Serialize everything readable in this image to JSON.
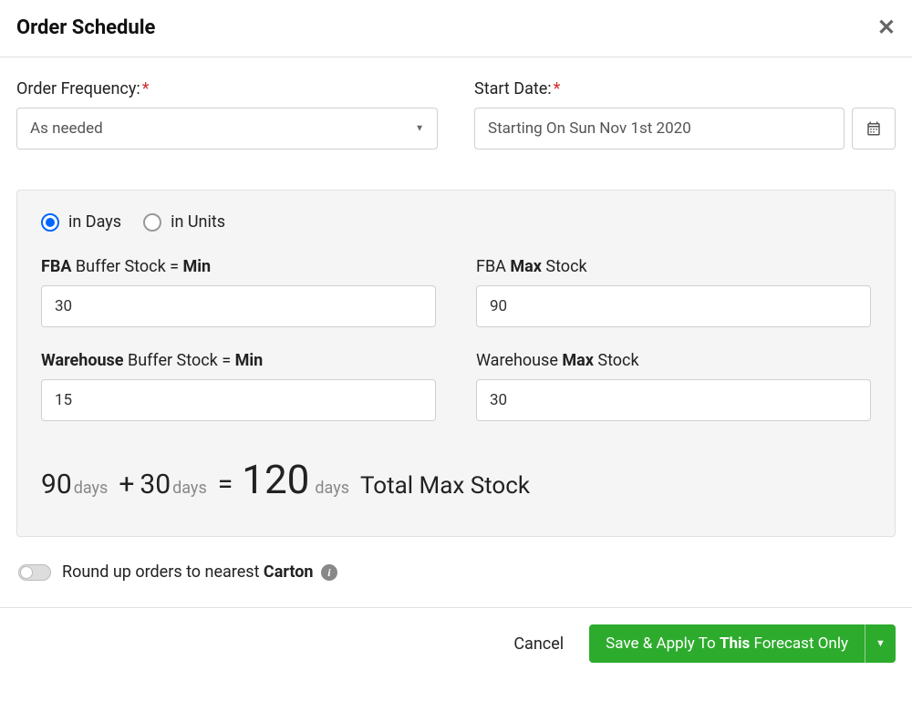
{
  "header": {
    "title": "Order Schedule"
  },
  "frequency": {
    "label": "Order Frequency:",
    "value": "As needed"
  },
  "start_date": {
    "label": "Start Date:",
    "value": "Starting On Sun Nov 1st 2020"
  },
  "mode": {
    "days": "in Days",
    "units": "in Units",
    "selected": "days"
  },
  "stock": {
    "fba_min_label_prefix": "FBA",
    "fba_min_label_mid": " Buffer Stock = ",
    "fba_min_label_suffix": "Min",
    "fba_min_value": "30",
    "fba_max_label_prefix": "FBA ",
    "fba_max_label_bold": "Max",
    "fba_max_label_suffix": " Stock",
    "fba_max_value": "90",
    "wh_min_label_prefix": "Warehouse",
    "wh_min_label_mid": " Buffer Stock = ",
    "wh_min_label_suffix": "Min",
    "wh_min_value": "15",
    "wh_max_label_prefix": "Warehouse ",
    "wh_max_label_bold": "Max",
    "wh_max_label_suffix": " Stock",
    "wh_max_value": "30"
  },
  "total": {
    "val1": "90",
    "val2": "30",
    "sum": "120",
    "days_unit": "days",
    "plus": "+",
    "equals": "=",
    "label": "Total Max Stock"
  },
  "round_up": {
    "prefix": "Round up orders to nearest ",
    "bold": "Carton"
  },
  "footer": {
    "cancel": "Cancel",
    "save_prefix": "Save & Apply To ",
    "save_bold": "This",
    "save_suffix": " Forecast Only"
  }
}
